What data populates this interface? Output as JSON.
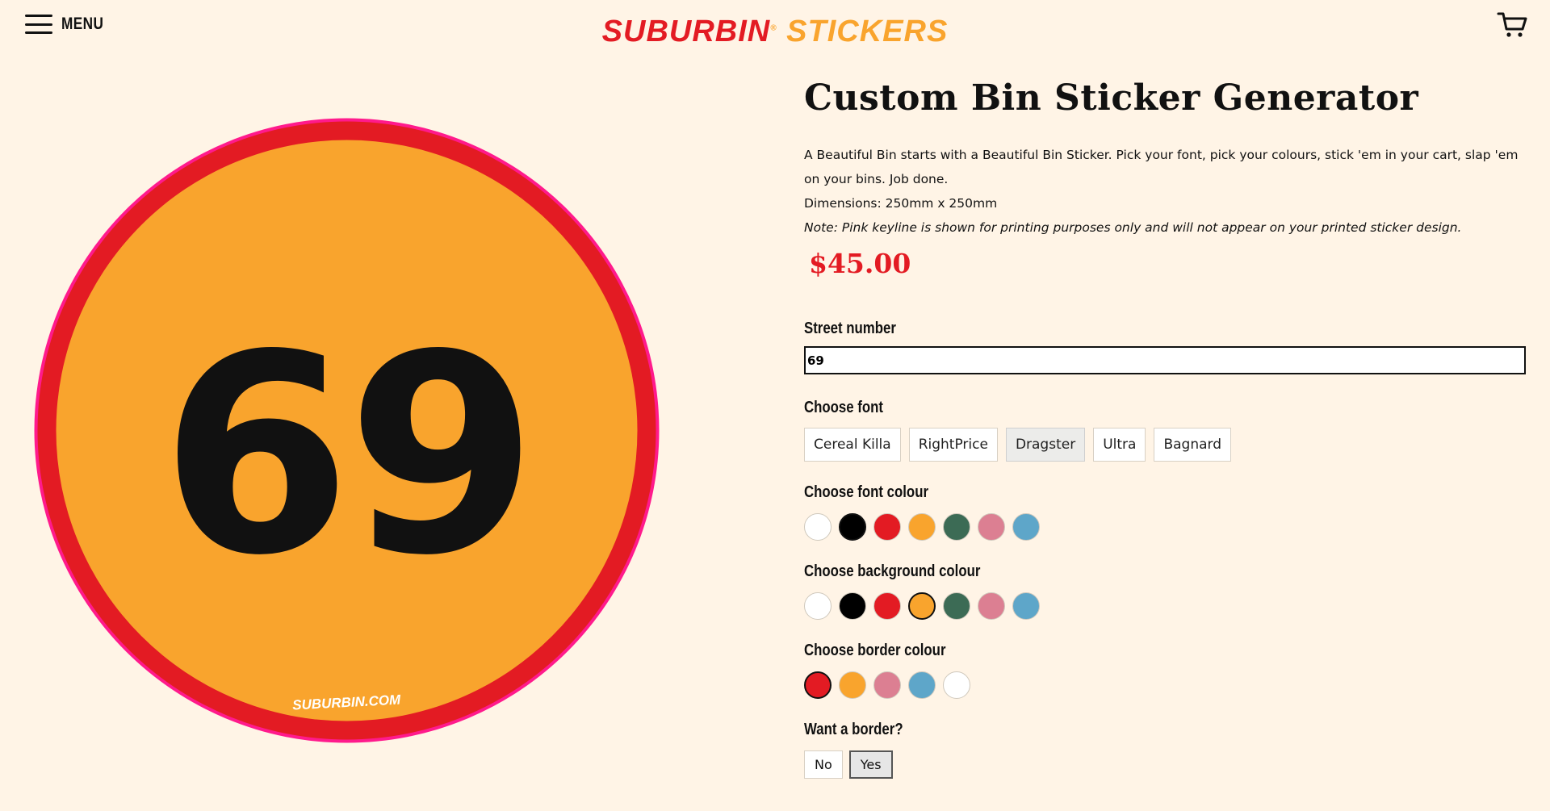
{
  "header": {
    "menu_label": "MENU",
    "logo": {
      "part1": "SUBURBIN",
      "part2": "®",
      "part3": " STICKERS"
    }
  },
  "preview": {
    "number": "69",
    "website": "SUBURBIN.COM",
    "font_colour": "#111111",
    "background_colour": "#f9a42d",
    "border_colour": "#e31b23",
    "keyline_colour": "#ff1a8c"
  },
  "product": {
    "title": "Custom Bin Sticker Generator",
    "description": "A Beautiful Bin starts with a Beautiful Bin Sticker. Pick your font, pick your colours, stick 'em in your cart, slap 'em on your bins. Job done.",
    "dimensions": "Dimensions: 250mm x 250mm",
    "note": "Note: Pink keyline is shown for printing purposes only and will not appear on your printed sticker design.",
    "price": "$45.00"
  },
  "street": {
    "label": "Street number",
    "value": "69"
  },
  "fonts": {
    "label": "Choose font",
    "options": [
      "Cereal Killa",
      "RightPrice",
      "Dragster",
      "Ultra",
      "Bagnard"
    ],
    "selected": "Dragster"
  },
  "font_colour": {
    "label": "Choose font colour",
    "swatches": [
      "#ffffff",
      "#000000",
      "#e31b23",
      "#f9a42d",
      "#3c6b55",
      "#dc7f92",
      "#5ea6c9"
    ],
    "selected": "#000000"
  },
  "background_colour": {
    "label": "Choose background colour",
    "swatches": [
      "#ffffff",
      "#000000",
      "#e31b23",
      "#f9a42d",
      "#3c6b55",
      "#dc7f92",
      "#5ea6c9"
    ],
    "selected": "#f9a42d"
  },
  "border_colour": {
    "label": "Choose border colour",
    "swatches": [
      "#e31b23",
      "#f9a42d",
      "#dc7f92",
      "#5ea6c9",
      "#ffffff"
    ],
    "selected": "#e31b23"
  },
  "border_toggle": {
    "label": "Want a border?",
    "options": [
      "No",
      "Yes"
    ],
    "selected": "Yes"
  },
  "icons": {
    "menu": "hamburger-icon",
    "cart": "cart-icon"
  }
}
